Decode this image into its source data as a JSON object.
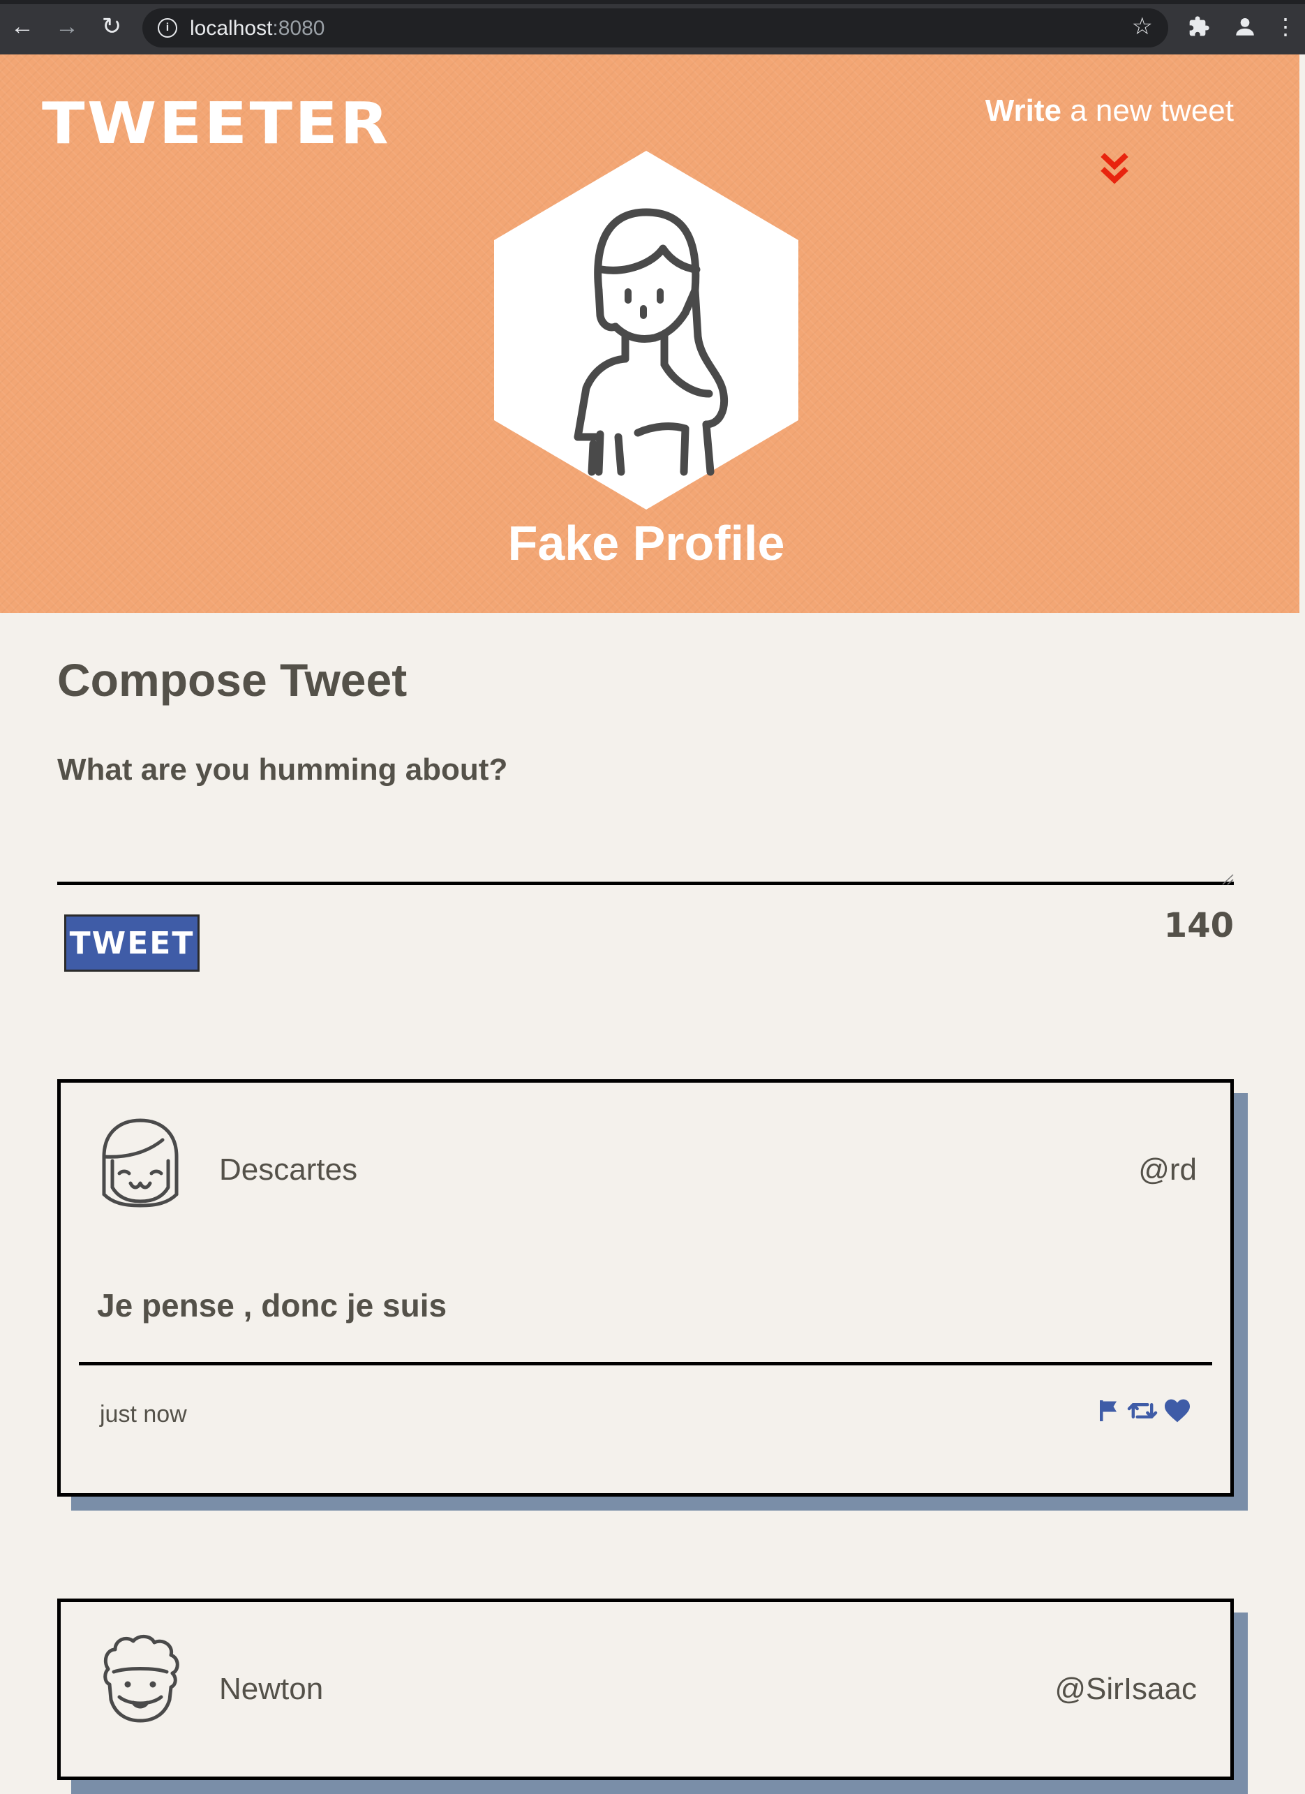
{
  "browser": {
    "url_host": "localhost",
    "url_port": ":8080"
  },
  "header": {
    "brand": "TWEETER",
    "nav_bold": "Write",
    "nav_rest": " a new tweet",
    "profile_name": "Fake Profile"
  },
  "compose": {
    "title": "Compose Tweet",
    "label": "What are you humming about?",
    "value": "",
    "button": "TWEET",
    "counter": "140"
  },
  "tweets": [
    {
      "author": "Descartes",
      "handle": "@rd",
      "content": "Je pense , donc je suis",
      "time": "just now"
    },
    {
      "author": "Newton",
      "handle": "@SirIsaac"
    }
  ],
  "colors": {
    "header_bg": "#f3a674",
    "page_bg": "#f4f1ec",
    "text": "#545149",
    "button_bg": "#3f5ca7",
    "icon_blue": "#3f5ca7",
    "shadow": "#7a8ea8",
    "chevron": "#e8240e"
  },
  "icons": [
    "back-icon",
    "forward-icon",
    "reload-icon",
    "info-icon",
    "bookmark-star-icon",
    "extensions-icon",
    "profile-icon",
    "menu-icon",
    "double-chevron-down-icon",
    "flag-icon",
    "retweet-icon",
    "heart-icon"
  ]
}
